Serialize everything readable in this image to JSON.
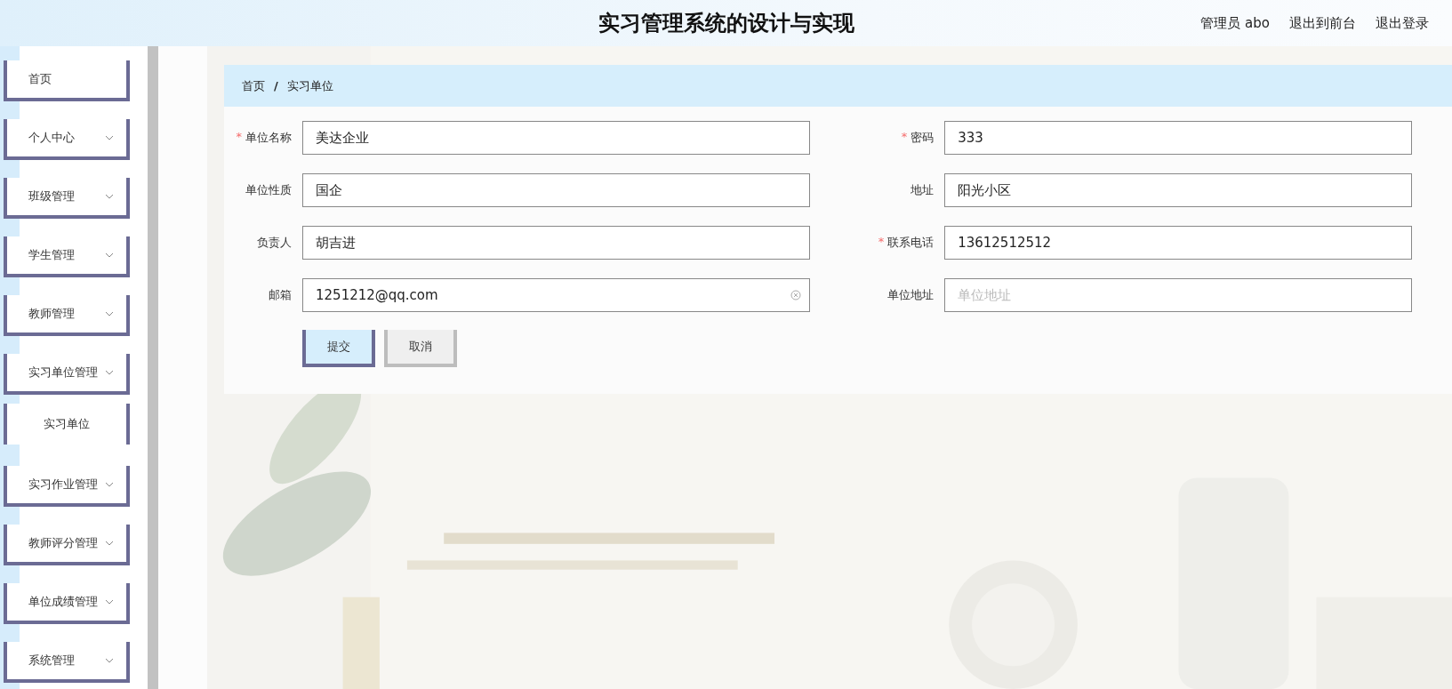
{
  "header": {
    "title": "实习管理系统的设计与实现",
    "links": [
      "管理员 abo",
      "退出到前台",
      "退出登录"
    ]
  },
  "sidebar": {
    "items": [
      {
        "label": "首页",
        "has_submenu": false
      },
      {
        "label": "个人中心",
        "has_submenu": true
      },
      {
        "label": "班级管理",
        "has_submenu": true
      },
      {
        "label": "学生管理",
        "has_submenu": true
      },
      {
        "label": "教师管理",
        "has_submenu": true
      },
      {
        "label": "实习单位管理",
        "has_submenu": true,
        "children": [
          {
            "label": "实习单位"
          }
        ]
      },
      {
        "label": "实习作业管理",
        "has_submenu": true
      },
      {
        "label": "教师评分管理",
        "has_submenu": true
      },
      {
        "label": "单位成绩管理",
        "has_submenu": true
      },
      {
        "label": "系统管理",
        "has_submenu": true
      }
    ]
  },
  "breadcrumb": {
    "items": [
      "首页",
      "实习单位"
    ],
    "separator": "/"
  },
  "form": {
    "required_mark": "*",
    "fields": [
      {
        "label": "单位名称",
        "required": true,
        "value": "美达企业",
        "clearable": false
      },
      {
        "label": "密码",
        "required": true,
        "value": "333",
        "clearable": false
      },
      {
        "label": "单位性质",
        "required": false,
        "value": "国企",
        "clearable": false
      },
      {
        "label": "地址",
        "required": false,
        "value": "阳光小区",
        "clearable": false
      },
      {
        "label": "负责人",
        "required": false,
        "value": "胡吉进",
        "clearable": false
      },
      {
        "label": "联系电话",
        "required": true,
        "value": "13612512512",
        "clearable": false
      },
      {
        "label": "邮箱",
        "required": false,
        "value": "1251212@qq.com",
        "clearable": true
      },
      {
        "label": "单位地址",
        "required": false,
        "placeholder": "单位地址",
        "clearable": false
      }
    ],
    "buttons": [
      {
        "label": "提交",
        "kind": "primary"
      },
      {
        "label": "取消",
        "kind": "default"
      }
    ]
  }
}
